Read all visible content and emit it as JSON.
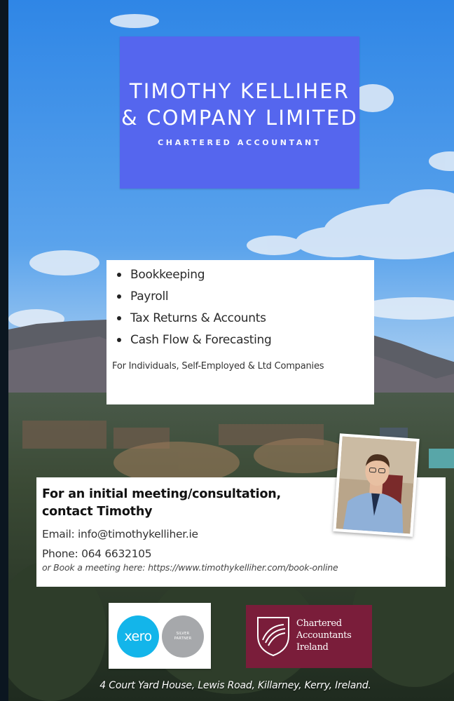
{
  "title": {
    "line1": "TIMOTHY KELLIHER",
    "line2": "& COMPANY LIMITED",
    "subtitle": "CHARTERED ACCOUNTANT"
  },
  "services": {
    "items": [
      "Bookkeeping",
      "Payroll",
      "Tax Returns & Accounts",
      "Cash Flow & Forecasting"
    ],
    "audience": "For Individuals, Self-Employed & Ltd Companies"
  },
  "contact": {
    "heading_line1": "For an initial meeting/consultation,",
    "heading_line2": "contact Timothy",
    "email_line": "Email: info@timothykelliher.ie",
    "phone_line": "Phone: 064 6632105",
    "booking_line": "or Book a meeting here: https://www.timothykelliher.com/book-online"
  },
  "logos": {
    "xero_text": "xero",
    "xero_partner_line1": "SILVER",
    "xero_partner_line2": "PARTNER",
    "cai_line1": "Chartered",
    "cai_line2": "Accountants",
    "cai_line3": "Ireland"
  },
  "footer": {
    "address": "4 Court Yard House, Lewis Road, Killarney, Kerry, Ireland."
  },
  "colors": {
    "title_panel": "#5566ee",
    "xero_blue": "#13b5ea",
    "cai_maroon": "#7a1d3a"
  }
}
